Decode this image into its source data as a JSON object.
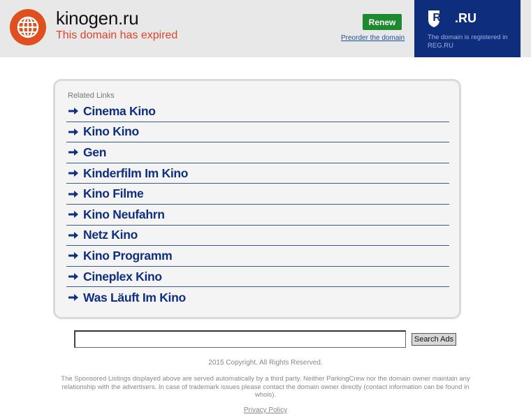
{
  "header": {
    "site_name": "kinogen.ru",
    "status": "This domain has expired",
    "renew_label": "Renew",
    "preorder_label": "Preorder the domain",
    "registrar": {
      "logo_reg": "REG",
      "logo_ru": ".RU",
      "note": "The domain is registered in REG.RU",
      "color": "#0f2d7d"
    },
    "icon": "globe-icon",
    "colors": {
      "globe": "#e0501f",
      "expired": "#e0442a",
      "renew": "#1e8a2e"
    }
  },
  "related": {
    "title": "Related Links",
    "arrow_icon": "arrow-right-icon",
    "links": [
      {
        "label": "Cinema Kino"
      },
      {
        "label": "Kino Kino"
      },
      {
        "label": "Gen"
      },
      {
        "label": "Kinderfilm Im Kino"
      },
      {
        "label": "Kino Filme"
      },
      {
        "label": "Kino Neufahrn"
      },
      {
        "label": "Netz Kino"
      },
      {
        "label": "Kino Programm"
      },
      {
        "label": "Cineplex Kino"
      },
      {
        "label": "Was Läuft Im Kino"
      }
    ],
    "link_color": "#0f2f82"
  },
  "search": {
    "value": "",
    "button_label": "Search Ads"
  },
  "footer": {
    "copyright": "2015 Copyright. All Rights Reserved.",
    "disclaimer": "The Sponsored Listings displayed above are served automatically by a third party. Neither ParkingCrew nor the domain owner maintain any relationship with the advertisers. In case of trademark issues please contact the domain owner directly (contact information can be found in whois).",
    "privacy_label": "Privacy Policy"
  }
}
